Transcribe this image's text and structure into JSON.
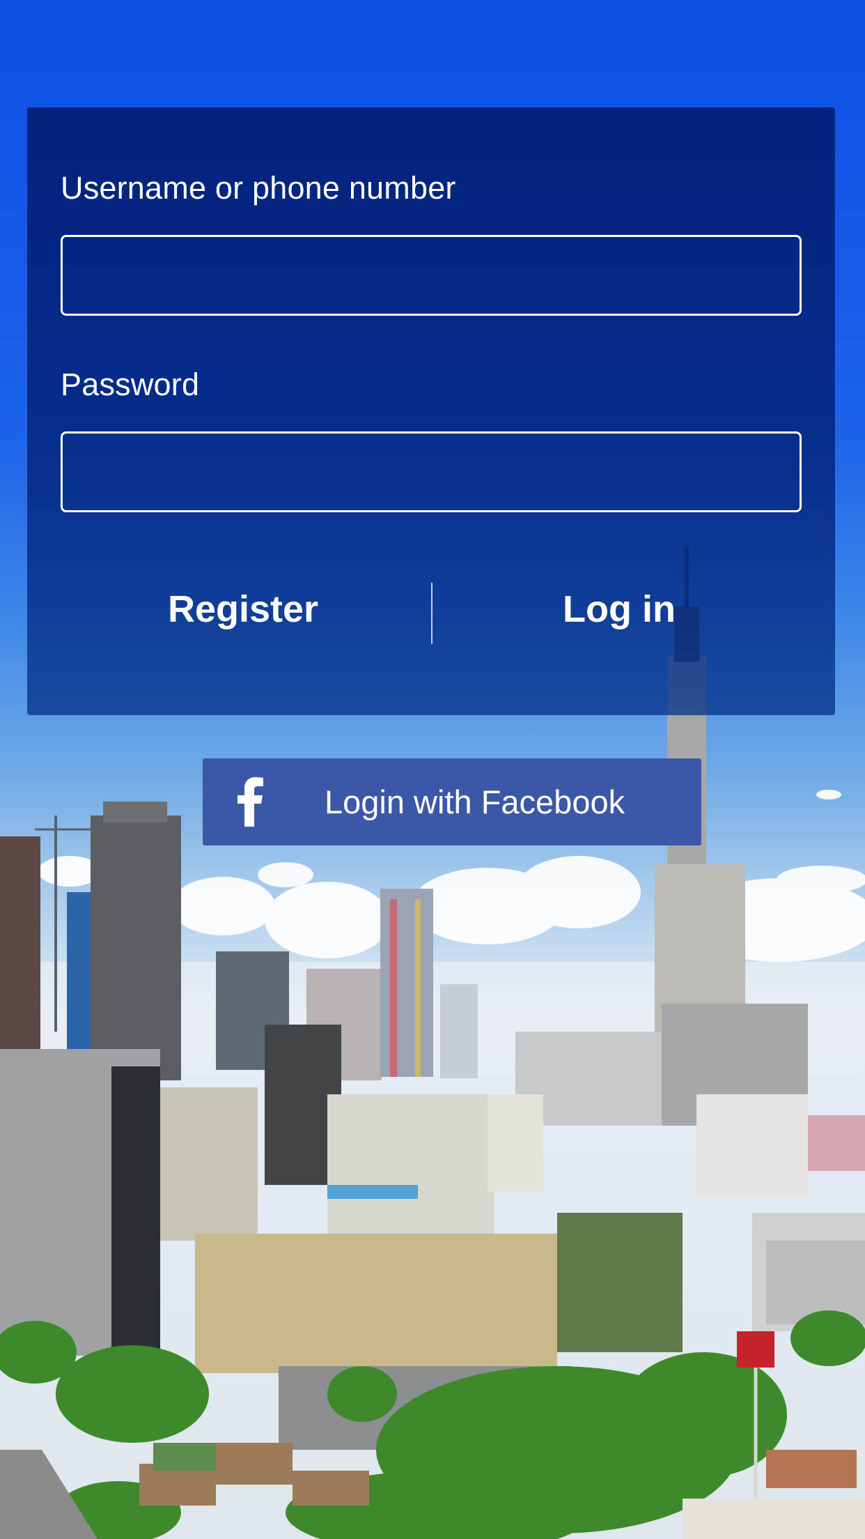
{
  "login_form": {
    "username_label": "Username or phone number",
    "username_value": "",
    "password_label": "Password",
    "password_value": "",
    "register_label": "Register",
    "login_label": "Log in"
  },
  "facebook_login": {
    "label": "Login with Facebook",
    "icon": "facebook-f-icon",
    "color": "#3b57a7"
  },
  "background": {
    "description_icon": "city-skyline-photo",
    "sky_color": "#0f4fe6"
  }
}
